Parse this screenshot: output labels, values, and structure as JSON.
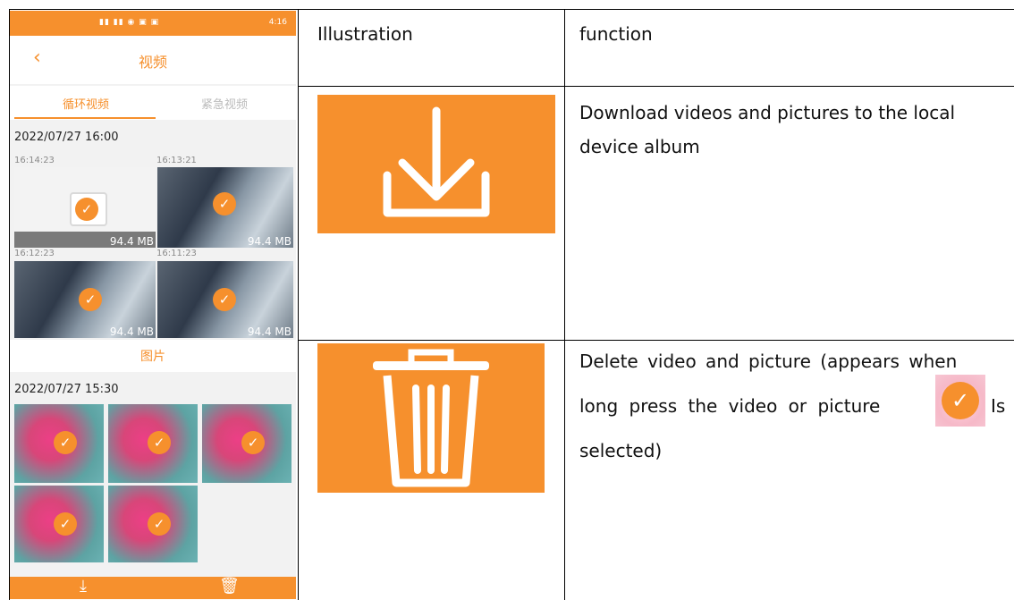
{
  "table": {
    "header": {
      "illustration": "Illustration",
      "function": "function"
    },
    "rows": [
      {
        "function_text_line1": "Download videos and pictures to the local",
        "function_text_line2": "device album",
        "icon": "download-icon"
      },
      {
        "function_text_line1": "Delete video and picture (appears when",
        "function_text_line2a": "long press the video or picture",
        "function_text_line2b": "Is",
        "function_text_line3": "selected)",
        "icon": "trash-icon"
      }
    ]
  },
  "phone": {
    "title": "视频",
    "tabs": [
      "循环视频",
      "紧急视频"
    ],
    "videos_date": "2022/07/27 16:00",
    "video_thumbs": [
      {
        "time": "16:14:23",
        "size": "94.4 MB"
      },
      {
        "time": "16:13:21",
        "size": "94.4 MB"
      },
      {
        "time": "16:12:23",
        "size": "94.4 MB"
      },
      {
        "time": "16:11:23",
        "size": "94.4 MB"
      }
    ],
    "pictures_title": "图片",
    "pictures_date": "2022/07/27 15:30",
    "status_time": "4:16",
    "bottom_icons": [
      "download-icon",
      "trash-icon"
    ]
  },
  "colors": {
    "accent": "#f6902d"
  }
}
